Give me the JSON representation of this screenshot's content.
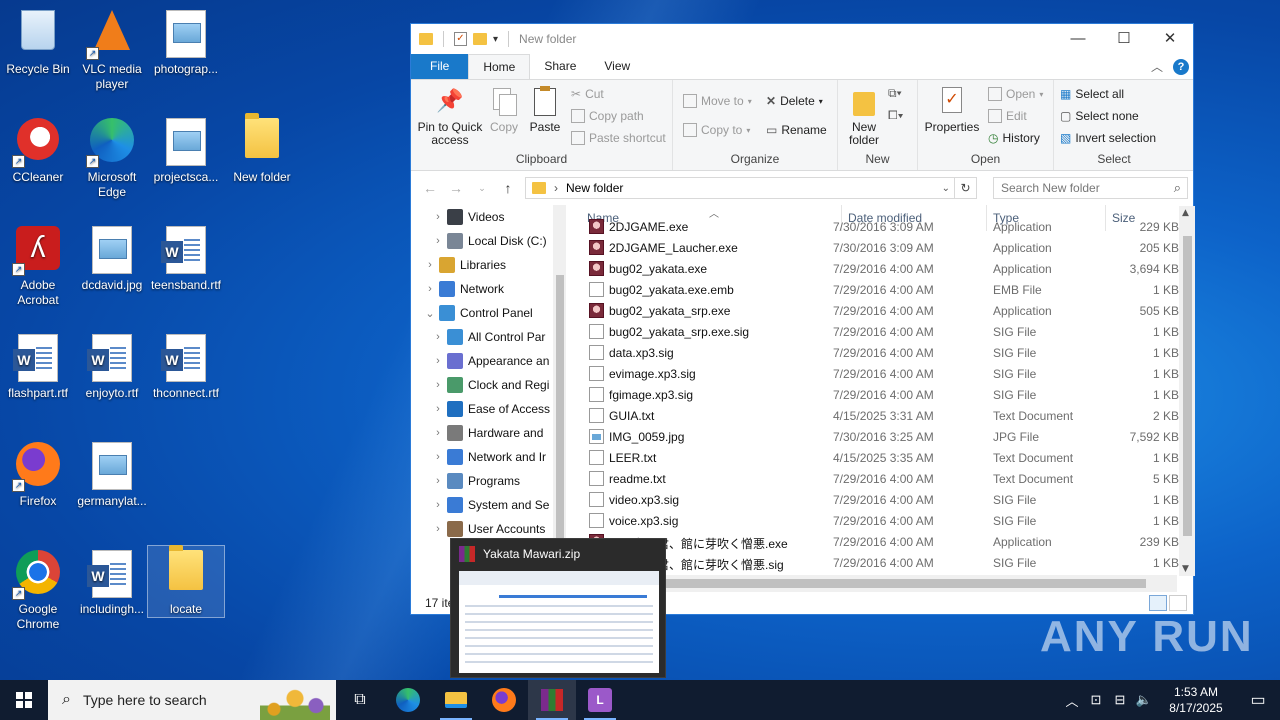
{
  "desktop": {
    "icons": [
      {
        "label": "Recycle Bin"
      },
      {
        "label": "VLC media player"
      },
      {
        "label": "photograp..."
      },
      {
        "label": "CCleaner"
      },
      {
        "label": "Microsoft Edge"
      },
      {
        "label": "projectsca..."
      },
      {
        "label": "New folder"
      },
      {
        "label": "Adobe Acrobat"
      },
      {
        "label": "dcdavid.jpg"
      },
      {
        "label": "teensband.rtf"
      },
      {
        "label": "flashpart.rtf"
      },
      {
        "label": "enjoyto.rtf"
      },
      {
        "label": "thconnect.rtf"
      },
      {
        "label": "Firefox"
      },
      {
        "label": "germanylat..."
      },
      {
        "label": "Google Chrome"
      },
      {
        "label": "includingh..."
      },
      {
        "label": "locate"
      }
    ],
    "watermark": "ANY RUN"
  },
  "explorer": {
    "title": "New folder",
    "tabs": {
      "file": "File",
      "home": "Home",
      "share": "Share",
      "view": "View"
    },
    "ribbon": {
      "pin": "Pin to Quick access",
      "copy": "Copy",
      "paste": "Paste",
      "cut": "Cut",
      "copy_path": "Copy path",
      "paste_shortcut": "Paste shortcut",
      "clipboard": "Clipboard",
      "move_to": "Move to",
      "copy_to": "Copy to",
      "delete": "Delete",
      "rename": "Rename",
      "organize": "Organize",
      "new_folder": "New folder",
      "new": "New",
      "properties": "Properties",
      "open": "Open",
      "edit": "Edit",
      "history": "History",
      "open_group": "Open",
      "select_all": "Select all",
      "select_none": "Select none",
      "invert_selection": "Invert selection",
      "select": "Select"
    },
    "address": {
      "path": "New folder",
      "search_placeholder": "Search New folder"
    },
    "nav": [
      {
        "label": "Videos",
        "color": "#3a3f47",
        "indent": 1,
        "chev": "›"
      },
      {
        "label": "Local Disk (C:)",
        "color": "#7a8696",
        "indent": 1,
        "chev": "›"
      },
      {
        "label": "Libraries",
        "color": "#d9a531",
        "indent": 0,
        "chev": "›"
      },
      {
        "label": "Network",
        "color": "#3a7bd5",
        "indent": 0,
        "chev": "›"
      },
      {
        "label": "Control Panel",
        "color": "#3a8fd5",
        "indent": 0,
        "chev": "⌄"
      },
      {
        "label": "All Control Par",
        "color": "#3a8fd5",
        "indent": 1,
        "chev": "›"
      },
      {
        "label": "Appearance an",
        "color": "#6a6fd0",
        "indent": 1,
        "chev": "›"
      },
      {
        "label": "Clock and Regi",
        "color": "#4a9a6a",
        "indent": 1,
        "chev": "›"
      },
      {
        "label": "Ease of Access",
        "color": "#1f6fc0",
        "indent": 1,
        "chev": "›"
      },
      {
        "label": "Hardware and",
        "color": "#7a7a7a",
        "indent": 1,
        "chev": "›"
      },
      {
        "label": "Network and Ir",
        "color": "#3a7bd5",
        "indent": 1,
        "chev": "›"
      },
      {
        "label": "Programs",
        "color": "#5a8ac0",
        "indent": 1,
        "chev": "›"
      },
      {
        "label": "System and Se",
        "color": "#3a7bd5",
        "indent": 1,
        "chev": "›"
      },
      {
        "label": "User Accounts",
        "color": "#8a6a4a",
        "indent": 1,
        "chev": "›"
      }
    ],
    "columns": {
      "name": "Name",
      "date": "Date modified",
      "type": "Type",
      "size": "Size"
    },
    "files": [
      {
        "name": "2DJGAME.exe",
        "date": "7/30/2016 3:09 AM",
        "type": "Application",
        "size": "229 KB",
        "icon": "app"
      },
      {
        "name": "2DJGAME_Laucher.exe",
        "date": "7/30/2016 3:09 AM",
        "type": "Application",
        "size": "205 KB",
        "icon": "app"
      },
      {
        "name": "bug02_yakata.exe",
        "date": "7/29/2016 4:00 AM",
        "type": "Application",
        "size": "3,694 KB",
        "icon": "app"
      },
      {
        "name": "bug02_yakata.exe.emb",
        "date": "7/29/2016 4:00 AM",
        "type": "EMB File",
        "size": "1 KB",
        "icon": "doc"
      },
      {
        "name": "bug02_yakata_srp.exe",
        "date": "7/29/2016 4:00 AM",
        "type": "Application",
        "size": "505 KB",
        "icon": "app"
      },
      {
        "name": "bug02_yakata_srp.exe.sig",
        "date": "7/29/2016 4:00 AM",
        "type": "SIG File",
        "size": "1 KB",
        "icon": "doc"
      },
      {
        "name": "data.xp3.sig",
        "date": "7/29/2016 4:00 AM",
        "type": "SIG File",
        "size": "1 KB",
        "icon": "doc"
      },
      {
        "name": "evimage.xp3.sig",
        "date": "7/29/2016 4:00 AM",
        "type": "SIG File",
        "size": "1 KB",
        "icon": "doc"
      },
      {
        "name": "fgimage.xp3.sig",
        "date": "7/29/2016 4:00 AM",
        "type": "SIG File",
        "size": "1 KB",
        "icon": "doc"
      },
      {
        "name": "GUIA.txt",
        "date": "4/15/2025 3:31 AM",
        "type": "Text Document",
        "size": "2 KB",
        "icon": "doc"
      },
      {
        "name": "IMG_0059.jpg",
        "date": "7/30/2016 3:25 AM",
        "type": "JPG File",
        "size": "7,592 KB",
        "icon": "jpg"
      },
      {
        "name": "LEER.txt",
        "date": "4/15/2025 3:35 AM",
        "type": "Text Document",
        "size": "1 KB",
        "icon": "doc"
      },
      {
        "name": "readme.txt",
        "date": "7/29/2016 4:00 AM",
        "type": "Text Document",
        "size": "5 KB",
        "icon": "doc"
      },
      {
        "name": "video.xp3.sig",
        "date": "7/29/2016 4:00 AM",
        "type": "SIG File",
        "size": "1 KB",
        "icon": "doc"
      },
      {
        "name": "voice.xp3.sig",
        "date": "7/29/2016 4:00 AM",
        "type": "SIG File",
        "size": "1 KB",
        "icon": "doc"
      },
      {
        "name": "死に逝く君、館に芽吹く憎悪.exe",
        "date": "7/29/2016 4:00 AM",
        "type": "Application",
        "size": "239 KB",
        "icon": "app"
      },
      {
        "name": "死に逝く君、館に芽吹く憎悪.sig",
        "date": "7/29/2016 4:00 AM",
        "type": "SIG File",
        "size": "1 KB",
        "icon": "doc"
      }
    ],
    "status": "17 items"
  },
  "thumbnail": {
    "title": "Yakata Mawari.zip"
  },
  "taskbar": {
    "search_placeholder": "Type here to search",
    "time": "1:53 AM",
    "date": "8/17/2025"
  }
}
